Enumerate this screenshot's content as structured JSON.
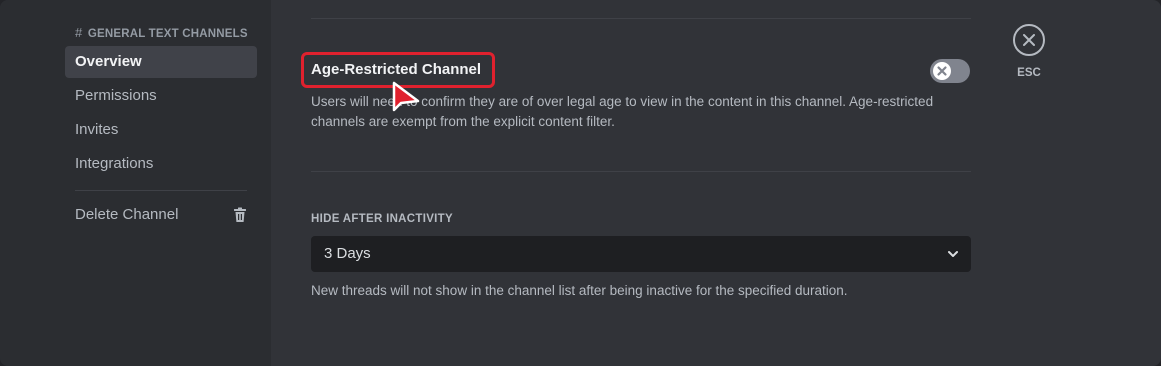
{
  "sidebar": {
    "header_hash": "#",
    "header_channel": "GENERAL",
    "header_category": "TEXT CHANNELS",
    "items": [
      {
        "label": "Overview"
      },
      {
        "label": "Permissions"
      },
      {
        "label": "Invites"
      },
      {
        "label": "Integrations"
      }
    ],
    "delete_label": "Delete Channel",
    "delete_icon": "trash-icon"
  },
  "age_restricted": {
    "title": "Age-Restricted Channel",
    "toggle_state": "off",
    "description": "Users will need to confirm they are of over legal age to view in the content in this channel. Age-restricted channels are exempt from the explicit content filter."
  },
  "hide_after_inactivity": {
    "label": "HIDE AFTER INACTIVITY",
    "selected": "3 Days",
    "help": "New threads will not show in the channel list after being inactive for the specified duration."
  },
  "close": {
    "label": "ESC",
    "icon": "close-icon"
  },
  "colors": {
    "background": "#313338",
    "sidebar": "#2b2d31",
    "highlight": "#e0212e",
    "toggle_off": "#80848e"
  }
}
